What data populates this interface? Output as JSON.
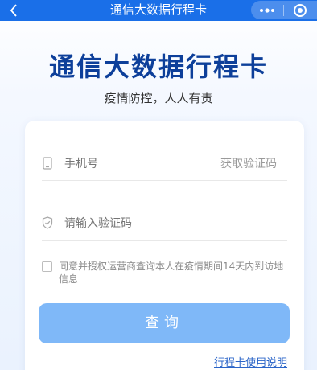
{
  "navbar": {
    "title": "通信大数据行程卡",
    "back_icon": "chevron-left-icon",
    "more_icon": "more-dots-icon",
    "close_icon": "target-circle-icon",
    "color": "#1a6fe8"
  },
  "header": {
    "title": "通信大数据行程卡",
    "subtitle": "疫情防控，人人有责",
    "title_color": "#0d3f9a"
  },
  "form": {
    "phone_placeholder": "手机号",
    "get_code_label": "获取验证码",
    "code_placeholder": "请输入验证码",
    "agreement_text": "同意并授权运营商查询本人在疫情期间14天内到访地信息",
    "agreement_checked": false,
    "submit_label": "查询",
    "button_color": "#7fb8f8"
  },
  "footer": {
    "help_link": "行程卡使用说明",
    "link_color": "#2a64c8"
  }
}
